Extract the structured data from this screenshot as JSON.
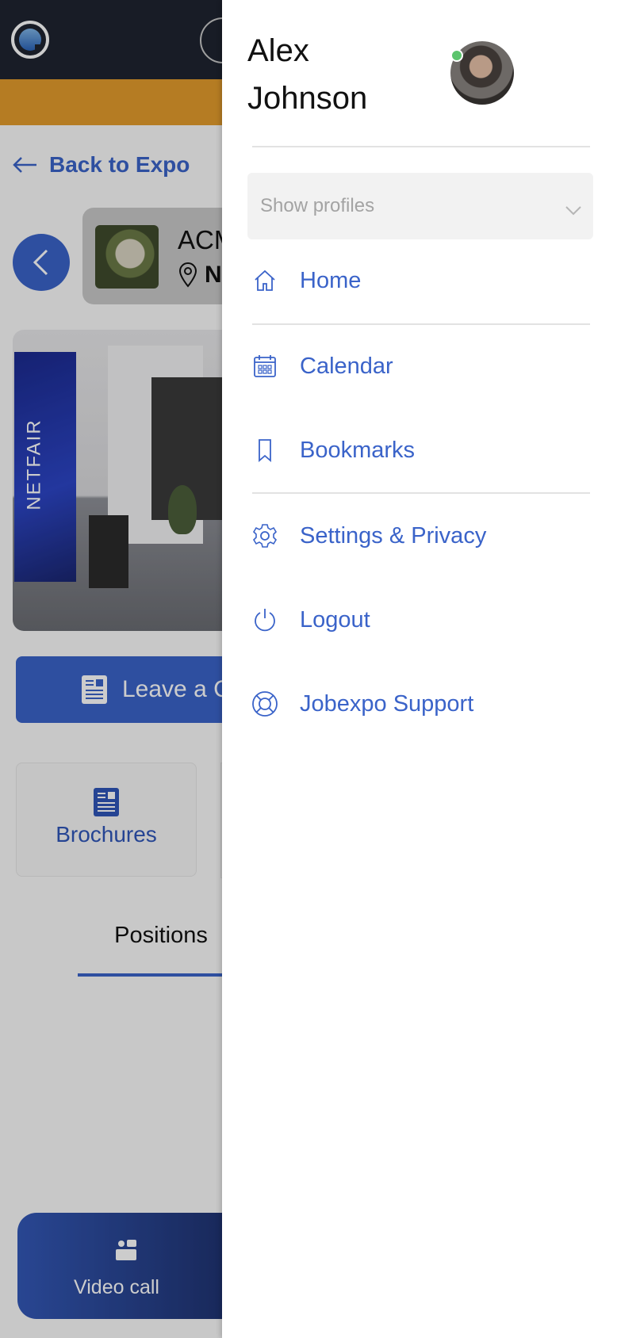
{
  "background": {
    "back_link": "Back to Expo",
    "company": {
      "name": "ACM",
      "location": "N"
    },
    "booth_banner": "NETFAIR",
    "cv_button": "Leave a CV",
    "tile": {
      "label": "Brochures",
      "icon": "brochure-icon"
    },
    "tab": "Positions",
    "video_call": "Video call"
  },
  "drawer": {
    "user_name": "Alex Johnson",
    "online": true,
    "profiles_placeholder": "Show profiles",
    "menu": [
      {
        "label": "Home",
        "icon": "home-icon"
      },
      {
        "label": "Calendar",
        "icon": "calendar-icon"
      },
      {
        "label": "Bookmarks",
        "icon": "bookmark-icon"
      },
      {
        "label": "Settings & Privacy",
        "icon": "gear-icon"
      },
      {
        "label": "Logout",
        "icon": "power-icon"
      },
      {
        "label": "Jobexpo Support",
        "icon": "lifebuoy-icon"
      }
    ]
  },
  "colors": {
    "accent": "#3a63c9",
    "banner": "#e39b2c",
    "topbar": "#1e2430",
    "online": "#5cc46d"
  }
}
